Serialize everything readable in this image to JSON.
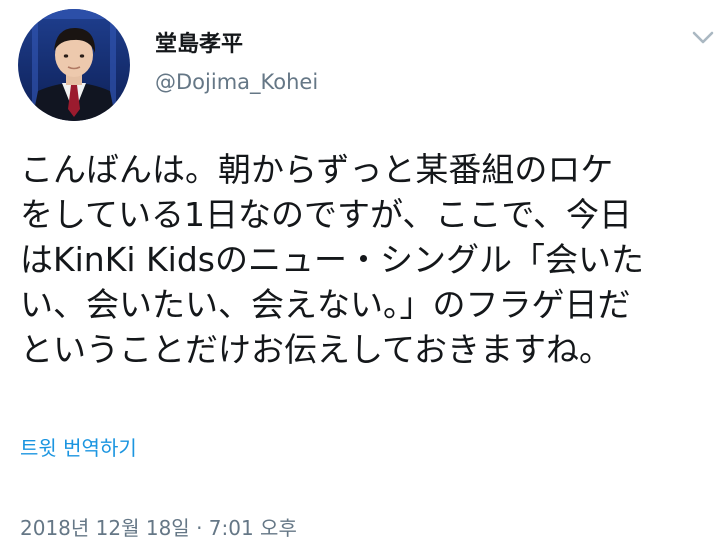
{
  "tweet": {
    "author": {
      "display_name": "堂島孝平",
      "handle": "@Dojima_Kohei",
      "avatar_icon": "profile-photo"
    },
    "menu_icon": "chevron-down-icon",
    "text_lines": [
      "こんばんは。朝からずっと某番組のロケ",
      "をしている1日なのですが、ここで、今日",
      "はKinKi Kidsのニュー・シングル「会いた",
      "い、会いたい、会えない。」のフラゲ日だ",
      "ということだけお伝えしておきますね。"
    ],
    "translate_label": "트윗 번역하기",
    "timestamp": "2018년 12월 18일 · 7:01 오후"
  },
  "colors": {
    "text": "#14171a",
    "secondary": "#657786",
    "link": "#1b95e0"
  }
}
